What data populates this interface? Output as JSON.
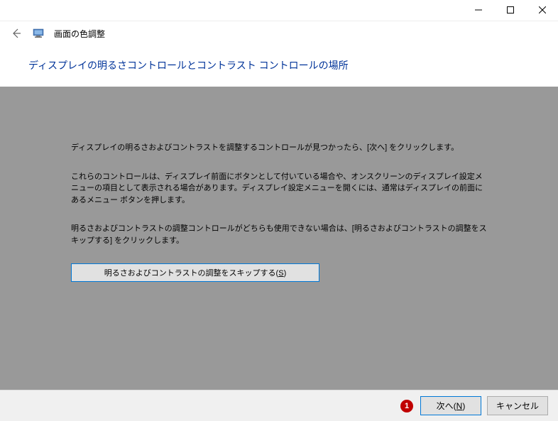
{
  "window": {
    "app_title": "画面の色調整"
  },
  "page": {
    "heading": "ディスプレイの明るさコントロールとコントラスト コントロールの場所"
  },
  "content": {
    "para1": "ディスプレイの明るさおよびコントラストを調整するコントロールが見つかったら、[次へ] をクリックします。",
    "para2": "これらのコントロールは、ディスプレイ前面にボタンとして付いている場合や、オンスクリーンのディスプレイ設定メニューの項目として表示される場合があります。ディスプレイ設定メニューを開くには、通常はディスプレイの前面にあるメニュー ボタンを押します。",
    "para3": "明るさおよびコントラストの調整コントロールがどちらも使用できない場合は、[明るさおよびコントラストの調整をスキップする] をクリックします。",
    "skip_button_text": "明るさおよびコントラストの調整をスキップする",
    "skip_button_key": "S"
  },
  "footer": {
    "badge": "1",
    "next_text": "次へ",
    "next_key": "N",
    "cancel_label": "キャンセル"
  }
}
